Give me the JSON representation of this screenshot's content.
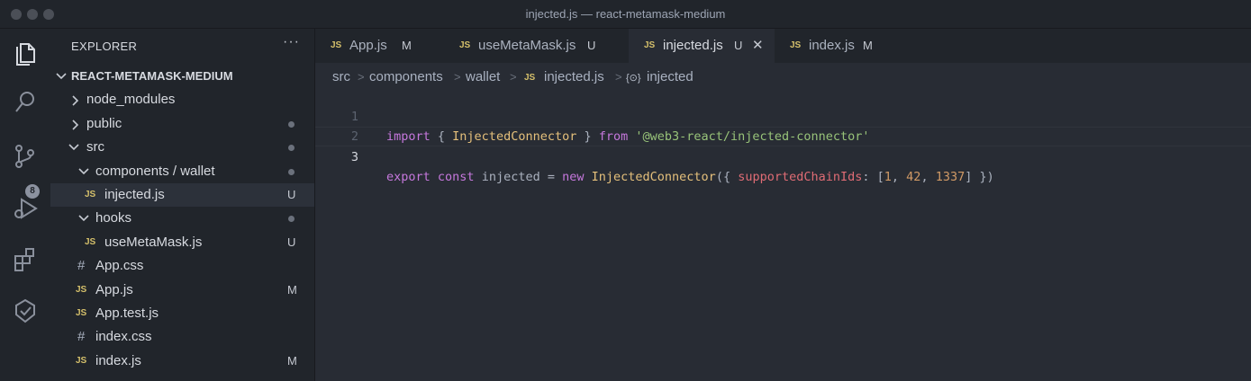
{
  "window": {
    "title": "injected.js — react-metamask-medium"
  },
  "activity_bar": {
    "items": [
      {
        "name": "explorer",
        "icon": "files-icon"
      },
      {
        "name": "search",
        "icon": "search-icon"
      },
      {
        "name": "source-control",
        "icon": "source-control-icon",
        "badge": "8"
      },
      {
        "name": "run-debug",
        "icon": "run-debug-icon"
      },
      {
        "name": "extensions",
        "icon": "extensions-icon"
      },
      {
        "name": "remote",
        "icon": "remote-icon"
      }
    ]
  },
  "sidebar": {
    "header": "EXPLORER",
    "more": "···",
    "root": "REACT-METAMASK-MEDIUM",
    "items": [
      {
        "label": "node_modules",
        "type": "folder",
        "expanded": false,
        "status": ""
      },
      {
        "label": "public",
        "type": "folder",
        "expanded": false,
        "status": "dot"
      },
      {
        "label": "src",
        "type": "folder",
        "expanded": true,
        "status": "dot"
      },
      {
        "label": "components / wallet",
        "type": "folder",
        "expanded": true,
        "status": "dot"
      },
      {
        "label": "injected.js",
        "type": "js",
        "selected": true,
        "status": "U"
      },
      {
        "label": "hooks",
        "type": "folder",
        "expanded": true,
        "status": "dot"
      },
      {
        "label": "useMetaMask.js",
        "type": "js",
        "status": "U"
      },
      {
        "label": "App.css",
        "type": "css",
        "status": ""
      },
      {
        "label": "App.js",
        "type": "js",
        "status": "M"
      },
      {
        "label": "App.test.js",
        "type": "js",
        "status": ""
      },
      {
        "label": "index.css",
        "type": "css",
        "status": ""
      },
      {
        "label": "index.js",
        "type": "js",
        "status": "M"
      }
    ],
    "js_icon": "JS",
    "css_icon": "#"
  },
  "tabs": [
    {
      "label": "App.js",
      "status": "M",
      "active": false
    },
    {
      "label": "useMetaMask.js",
      "status": "U",
      "active": false
    },
    {
      "label": "injected.js",
      "status": "U",
      "active": true,
      "close": "✕"
    },
    {
      "label": "index.js",
      "status": "M",
      "active": false
    }
  ],
  "breadcrumb": {
    "parts": [
      "src",
      "components",
      "wallet",
      "injected.js",
      "injected"
    ],
    "symbol_icon": "{⊙}"
  },
  "editor": {
    "lines": [
      {
        "number": "1",
        "current": false
      },
      {
        "number": "2",
        "current": false
      },
      {
        "number": "3",
        "current": true
      }
    ],
    "tokens": {
      "l1_import": "import",
      "l1_open": " { ",
      "l1_class": "InjectedConnector",
      "l1_close": " } ",
      "l1_from": "from",
      "l1_space": " ",
      "l1_string": "'@web3-react/injected-connector'",
      "l3_export": "export",
      "l3_sp1": " ",
      "l3_const": "const",
      "l3_name": " injected = ",
      "l3_new": "new",
      "l3_sp2": " ",
      "l3_class": "InjectedConnector",
      "l3_paren": "({ ",
      "l3_prop": "supportedChainIds",
      "l3_colon": ": [",
      "l3_n1": "1",
      "l3_c1": ", ",
      "l3_n2": "42",
      "l3_c2": ", ",
      "l3_n3": "1337",
      "l3_end": "] })"
    }
  },
  "colors": {
    "background": "#282c34",
    "sidebar": "#21252b",
    "js_icon": "#d5c06b",
    "keyword": "#c678dd",
    "string": "#98c379",
    "class": "#e5c07b",
    "property": "#e06c75",
    "number": "#d19a66"
  }
}
